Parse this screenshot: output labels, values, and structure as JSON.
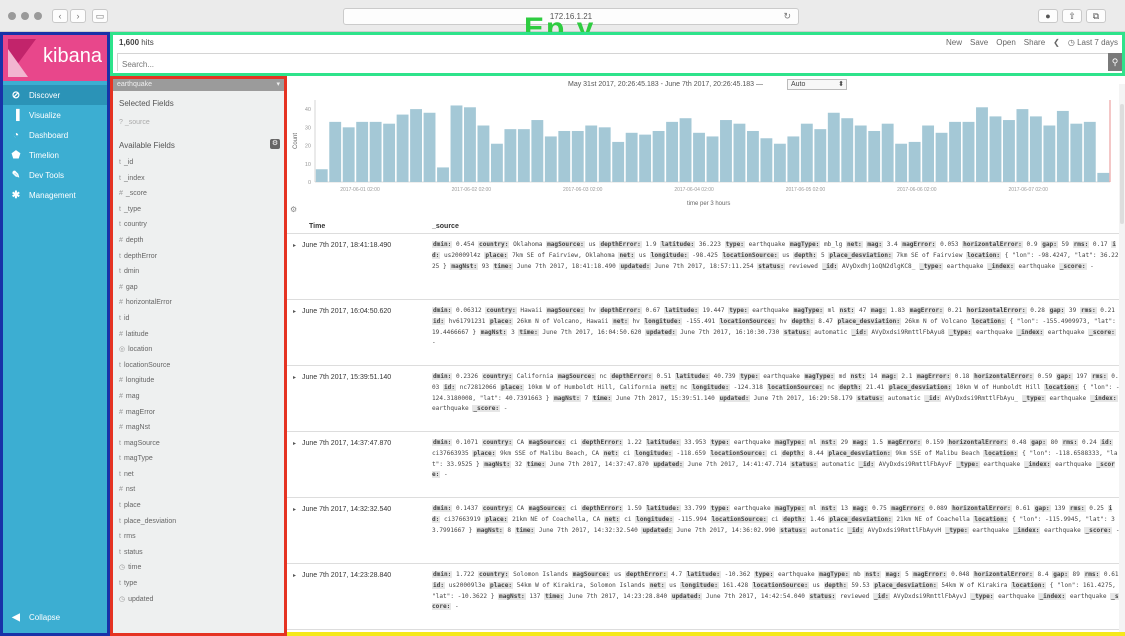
{
  "browser": {
    "address": "172.16.1.21",
    "title_fragment": "Ep    y"
  },
  "nav": {
    "logo": "kibana",
    "items": [
      {
        "label": "Discover",
        "icon": "compass-icon"
      },
      {
        "label": "Visualize",
        "icon": "bar-chart-icon"
      },
      {
        "label": "Dashboard",
        "icon": "dashboard-icon"
      },
      {
        "label": "Timelion",
        "icon": "shield-icon"
      },
      {
        "label": "Dev Tools",
        "icon": "wrench-icon"
      },
      {
        "label": "Management",
        "icon": "gear-icon"
      }
    ],
    "collapse": "Collapse"
  },
  "topbar": {
    "hits": "1,600",
    "hits_label": "hits",
    "actions": [
      "New",
      "Save",
      "Open",
      "Share"
    ],
    "time_range": "Last 7 days",
    "search_placeholder": "Search..."
  },
  "fields": {
    "index": "earthquake",
    "selected_title": "Selected Fields",
    "selected_source": "_source",
    "available_title": "Available Fields",
    "list": [
      {
        "t": "t",
        "n": "_id"
      },
      {
        "t": "t",
        "n": "_index"
      },
      {
        "t": "#",
        "n": "_score"
      },
      {
        "t": "t",
        "n": "_type"
      },
      {
        "t": "t",
        "n": "country"
      },
      {
        "t": "#",
        "n": "depth"
      },
      {
        "t": "t",
        "n": "depthError"
      },
      {
        "t": "t",
        "n": "dmin"
      },
      {
        "t": "#",
        "n": "gap"
      },
      {
        "t": "#",
        "n": "horizontalError"
      },
      {
        "t": "t",
        "n": "id"
      },
      {
        "t": "#",
        "n": "latitude"
      },
      {
        "t": "◎",
        "n": "location"
      },
      {
        "t": "t",
        "n": "locationSource"
      },
      {
        "t": "#",
        "n": "longitude"
      },
      {
        "t": "#",
        "n": "mag"
      },
      {
        "t": "#",
        "n": "magError"
      },
      {
        "t": "#",
        "n": "magNst"
      },
      {
        "t": "t",
        "n": "magSource"
      },
      {
        "t": "t",
        "n": "magType"
      },
      {
        "t": "t",
        "n": "net"
      },
      {
        "t": "#",
        "n": "nst"
      },
      {
        "t": "t",
        "n": "place"
      },
      {
        "t": "t",
        "n": "place_desviation"
      },
      {
        "t": "t",
        "n": "rms"
      },
      {
        "t": "t",
        "n": "status"
      },
      {
        "t": "◷",
        "n": "time"
      },
      {
        "t": "t",
        "n": "type"
      },
      {
        "t": "◷",
        "n": "updated"
      }
    ]
  },
  "main": {
    "range_text": "May 31st 2017, 20:26:45.183 - June 7th 2017, 20:26:45.183 —",
    "interval": "Auto",
    "x_axis_label": "time per 3 hours",
    "col_time": "Time",
    "col_source": "_source"
  },
  "chart_data": {
    "type": "bar",
    "ylabel": "Count",
    "xlabel": "time per 3 hours",
    "ylim": [
      0,
      45
    ],
    "yticks": [
      10,
      20,
      30,
      40
    ],
    "tick_labels": [
      "2017-06-01 02:00",
      "2017-06-02 02:00",
      "2017-06-03 02:00",
      "2017-06-04 02:00",
      "2017-06-05 02:00",
      "2017-06-06 02:00",
      "2017-06-07 02:00"
    ],
    "values": [
      7,
      33,
      30,
      33,
      33,
      32,
      37,
      40,
      38,
      8,
      42,
      41,
      31,
      21,
      29,
      29,
      34,
      25,
      28,
      28,
      31,
      30,
      22,
      27,
      26,
      28,
      33,
      35,
      27,
      25,
      34,
      32,
      28,
      24,
      21,
      25,
      32,
      29,
      38,
      35,
      31,
      28,
      32,
      21,
      22,
      31,
      27,
      33,
      33,
      41,
      36,
      34,
      40,
      36,
      31,
      39,
      32,
      33,
      5
    ]
  },
  "rows": [
    {
      "time": "June 7th 2017, 18:41:18.490",
      "src": [
        [
          "dmin:",
          "0.454"
        ],
        [
          "country:",
          "Oklahoma"
        ],
        [
          "magSource:",
          "us"
        ],
        [
          "depthError:",
          "1.9"
        ],
        [
          "latitude:",
          "36.223"
        ],
        [
          "type:",
          "earthquake"
        ],
        [
          "magType:",
          "mb_lg"
        ],
        [
          "net:",
          ""
        ],
        [
          "mag:",
          "3.4"
        ],
        [
          "magError:",
          "0.053"
        ],
        [
          "horizontalError:",
          "0.9"
        ],
        [
          "gap:",
          "59"
        ],
        [
          "rms:",
          "0.17"
        ],
        [
          "id:",
          "us20009l4z"
        ],
        [
          "place:",
          "7km SE of Fairview, Oklahoma"
        ],
        [
          "net:",
          "us"
        ],
        [
          "longitude:",
          "-98.425"
        ],
        [
          "locationSource:",
          "us"
        ],
        [
          "depth:",
          "5"
        ],
        [
          "place_desviation:",
          "7km SE of Fairview"
        ],
        [
          "location:",
          "{ \"lon\": -98.4247, \"lat\": 36.2225 }"
        ],
        [
          "magNst:",
          "93"
        ],
        [
          "time:",
          "June 7th 2017, 18:41:18.490"
        ],
        [
          "updated:",
          "June 7th 2017, 18:57:11.254"
        ],
        [
          "status:",
          "reviewed"
        ],
        [
          "_id:",
          "AVyDxdhj1oQN2dlgKC8_"
        ],
        [
          "_type:",
          "earthquake"
        ],
        [
          "_index:",
          "earthquake"
        ],
        [
          "_score:",
          "-"
        ]
      ]
    },
    {
      "time": "June 7th 2017, 16:04:50.620",
      "src": [
        [
          "dmin:",
          "0.06312"
        ],
        [
          "country:",
          "Hawaii"
        ],
        [
          "magSource:",
          "hv"
        ],
        [
          "depthError:",
          "0.67"
        ],
        [
          "latitude:",
          "19.447"
        ],
        [
          "type:",
          "earthquake"
        ],
        [
          "magType:",
          "ml"
        ],
        [
          "nst:",
          "47"
        ],
        [
          "mag:",
          "1.83"
        ],
        [
          "magError:",
          "0.21"
        ],
        [
          "horizontalError:",
          "0.28"
        ],
        [
          "gap:",
          "39"
        ],
        [
          "rms:",
          "0.21"
        ],
        [
          "id:",
          "hv61791231"
        ],
        [
          "place:",
          "26km N of Volcano, Hawaii"
        ],
        [
          "net:",
          "hv"
        ],
        [
          "longitude:",
          "-155.491"
        ],
        [
          "locationSource:",
          "hv"
        ],
        [
          "depth:",
          "8.47"
        ],
        [
          "place_desviation:",
          "26km N of Volcano"
        ],
        [
          "location:",
          "{ \"lon\": -155.4909973, \"lat\": 19.4466667 }"
        ],
        [
          "magNst:",
          "3"
        ],
        [
          "time:",
          "June 7th 2017, 16:04:50.620"
        ],
        [
          "updated:",
          "June 7th 2017, 16:10:30.730"
        ],
        [
          "status:",
          "automatic"
        ],
        [
          "_id:",
          "AVyDxdsi9RmttlFbAyu8"
        ],
        [
          "_type:",
          "earthquake"
        ],
        [
          "_index:",
          "earthquake"
        ],
        [
          "_score:",
          "-"
        ]
      ]
    },
    {
      "time": "June 7th 2017, 15:39:51.140",
      "src": [
        [
          "dmin:",
          "0.2326"
        ],
        [
          "country:",
          "California"
        ],
        [
          "magSource:",
          "nc"
        ],
        [
          "depthError:",
          "0.51"
        ],
        [
          "latitude:",
          "40.739"
        ],
        [
          "type:",
          "earthquake"
        ],
        [
          "magType:",
          "md"
        ],
        [
          "nst:",
          "14"
        ],
        [
          "mag:",
          "2.1"
        ],
        [
          "magError:",
          "0.18"
        ],
        [
          "horizontalError:",
          "0.59"
        ],
        [
          "gap:",
          "197"
        ],
        [
          "rms:",
          "0.03"
        ],
        [
          "id:",
          "nc72812066"
        ],
        [
          "place:",
          "10km W of Humboldt Hill, California"
        ],
        [
          "net:",
          "nc"
        ],
        [
          "longitude:",
          "-124.318"
        ],
        [
          "locationSource:",
          "nc"
        ],
        [
          "depth:",
          "21.41"
        ],
        [
          "place_desviation:",
          "10km W of Humboldt Hill"
        ],
        [
          "location:",
          "{ \"lon\": -124.3180008, \"lat\": 40.7391663 }"
        ],
        [
          "magNst:",
          "7"
        ],
        [
          "time:",
          "June 7th 2017, 15:39:51.140"
        ],
        [
          "updated:",
          "June 7th 2017, 16:29:58.179"
        ],
        [
          "status:",
          "automatic"
        ],
        [
          "_id:",
          "AVyDxdsi9RmttlFbAyu_"
        ],
        [
          "_type:",
          "earthquake"
        ],
        [
          "_index:",
          "earthquake"
        ],
        [
          "_score:",
          "-"
        ]
      ]
    },
    {
      "time": "June 7th 2017, 14:37:47.870",
      "src": [
        [
          "dmin:",
          "0.1071"
        ],
        [
          "country:",
          "CA"
        ],
        [
          "magSource:",
          "ci"
        ],
        [
          "depthError:",
          "1.22"
        ],
        [
          "latitude:",
          "33.953"
        ],
        [
          "type:",
          "earthquake"
        ],
        [
          "magType:",
          "ml"
        ],
        [
          "nst:",
          "29"
        ],
        [
          "mag:",
          "1.5"
        ],
        [
          "magError:",
          "0.159"
        ],
        [
          "horizontalError:",
          "0.48"
        ],
        [
          "gap:",
          "80"
        ],
        [
          "rms:",
          "0.24"
        ],
        [
          "id:",
          "ci37663935"
        ],
        [
          "place:",
          "9km SSE of Malibu Beach, CA"
        ],
        [
          "net:",
          "ci"
        ],
        [
          "longitude:",
          "-118.659"
        ],
        [
          "locationSource:",
          "ci"
        ],
        [
          "depth:",
          "8.44"
        ],
        [
          "place_desviation:",
          "9km SSE of Malibu Beach"
        ],
        [
          "location:",
          "{ \"lon\": -118.6588333, \"lat\": 33.9525 }"
        ],
        [
          "magNst:",
          "32"
        ],
        [
          "time:",
          "June 7th 2017, 14:37:47.870"
        ],
        [
          "updated:",
          "June 7th 2017, 14:41:47.714"
        ],
        [
          "status:",
          "automatic"
        ],
        [
          "_id:",
          "AVyDxdsi9RmttlFbAyvF"
        ],
        [
          "_type:",
          "earthquake"
        ],
        [
          "_index:",
          "earthquake"
        ],
        [
          "_score:",
          "-"
        ]
      ]
    },
    {
      "time": "June 7th 2017, 14:32:32.540",
      "src": [
        [
          "dmin:",
          "0.1437"
        ],
        [
          "country:",
          "CA"
        ],
        [
          "magSource:",
          "ci"
        ],
        [
          "depthError:",
          "1.59"
        ],
        [
          "latitude:",
          "33.799"
        ],
        [
          "type:",
          "earthquake"
        ],
        [
          "magType:",
          "ml"
        ],
        [
          "nst:",
          "13"
        ],
        [
          "mag:",
          "0.75"
        ],
        [
          "magError:",
          "0.089"
        ],
        [
          "horizontalError:",
          "0.61"
        ],
        [
          "gap:",
          "139"
        ],
        [
          "rms:",
          "0.25"
        ],
        [
          "id:",
          "ci37663919"
        ],
        [
          "place:",
          "21km NE of Coachella, CA"
        ],
        [
          "net:",
          "ci"
        ],
        [
          "longitude:",
          "-115.994"
        ],
        [
          "locationSource:",
          "ci"
        ],
        [
          "depth:",
          "1.46"
        ],
        [
          "place_desviation:",
          "21km NE of Coachella"
        ],
        [
          "location:",
          "{ \"lon\": -115.9945, \"lat\": 33.7991667 }"
        ],
        [
          "magNst:",
          "8"
        ],
        [
          "time:",
          "June 7th 2017, 14:32:32.540"
        ],
        [
          "updated:",
          "June 7th 2017, 14:36:02.990"
        ],
        [
          "status:",
          "automatic"
        ],
        [
          "_id:",
          "AVyDxdsi9RmttlFbAyvH"
        ],
        [
          "_type:",
          "earthquake"
        ],
        [
          "_index:",
          "earthquake"
        ],
        [
          "_score:",
          "-"
        ]
      ]
    },
    {
      "time": "June 7th 2017, 14:23:28.840",
      "src": [
        [
          "dmin:",
          "1.722"
        ],
        [
          "country:",
          "Solomon Islands"
        ],
        [
          "magSource:",
          "us"
        ],
        [
          "depthError:",
          "4.7"
        ],
        [
          "latitude:",
          "-10.362"
        ],
        [
          "type:",
          "earthquake"
        ],
        [
          "magType:",
          "mb"
        ],
        [
          "nst:",
          ""
        ],
        [
          "mag:",
          "5"
        ],
        [
          "magError:",
          "0.048"
        ],
        [
          "horizontalError:",
          "8.4"
        ],
        [
          "gap:",
          "89"
        ],
        [
          "rms:",
          "0.61"
        ],
        [
          "id:",
          "us20009l3e"
        ],
        [
          "place:",
          "54km W of Kirakira, Solomon Islands"
        ],
        [
          "net:",
          "us"
        ],
        [
          "longitude:",
          "161.428"
        ],
        [
          "locationSource:",
          "us"
        ],
        [
          "depth:",
          "59.53"
        ],
        [
          "place_desviation:",
          "54km W of Kirakira"
        ],
        [
          "location:",
          "{ \"lon\": 161.4275, \"lat\": -10.3622 }"
        ],
        [
          "magNst:",
          "137"
        ],
        [
          "time:",
          "June 7th 2017, 14:23:28.840"
        ],
        [
          "updated:",
          "June 7th 2017, 14:42:54.040"
        ],
        [
          "status:",
          "reviewed"
        ],
        [
          "_id:",
          "AVyDxdsi9RmttlFbAyvJ"
        ],
        [
          "_type:",
          "earthquake"
        ],
        [
          "_index:",
          "earthquake"
        ],
        [
          "_score:",
          "-"
        ]
      ]
    }
  ]
}
